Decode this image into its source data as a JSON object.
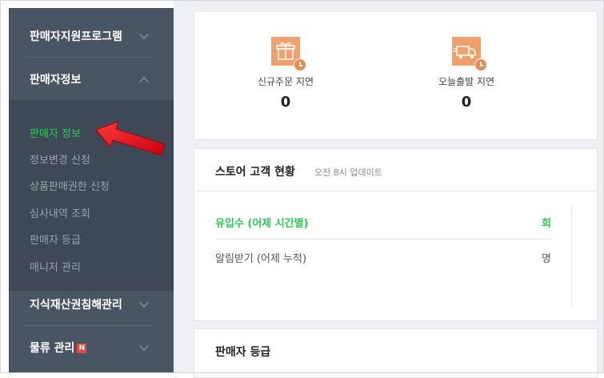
{
  "sidebar": {
    "seller_support": "판매자지원프로그램",
    "seller_info": "판매자정보",
    "sub_items": [
      "판매자 정보",
      "정보변경 신청",
      "상품판매권한 신청",
      "심사내역 조회",
      "판매자 등급",
      "매니저 관리"
    ],
    "ip_infringement": "지식재산권침해관리",
    "logistics": "물류 관리",
    "logistics_badge": "N"
  },
  "delay_stats": [
    {
      "label": "신규주문 지연",
      "value": "0",
      "icon": "gift-icon"
    },
    {
      "label": "오늘출발 지연",
      "value": "0",
      "icon": "truck-icon"
    }
  ],
  "customer_status": {
    "title": "스토어 고객 현황",
    "update_note": "오전 8시 업데이트",
    "rows": [
      {
        "label": "유입수 (어제 시간별)",
        "unit": "회"
      },
      {
        "label": "알림받기 (어제 누적)",
        "unit": "명"
      }
    ]
  },
  "seller_grade": {
    "title": "판매자 등급"
  },
  "colors": {
    "sidebar_bg": "#4a5564",
    "submenu_bg": "#3f4856",
    "active_green": "#2fc65a",
    "icon_orange": "#f0a06c",
    "arrow_red": "#e0101b"
  }
}
